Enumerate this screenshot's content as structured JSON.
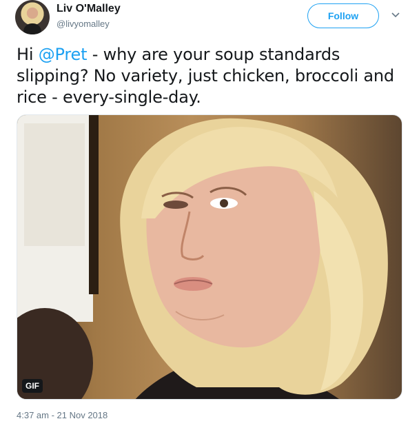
{
  "user": {
    "name": "Liv O'Malley",
    "handle": "@livyomalley"
  },
  "follow_label": "Follow",
  "tweet": {
    "prefix": "Hi ",
    "mention": "@Pret",
    "body": " - why are your soup standards slipping? No variety, just chicken, broccoli and rice - every-single-day."
  },
  "media": {
    "badge": "GIF",
    "content": "blonde woman pouting"
  },
  "timestamp": "4:37 am - 21 Nov 2018",
  "colors": {
    "accent": "#1da1f2",
    "text": "#14171a",
    "secondary": "#657786"
  },
  "icons": {
    "caret": "chevron-down-icon"
  }
}
